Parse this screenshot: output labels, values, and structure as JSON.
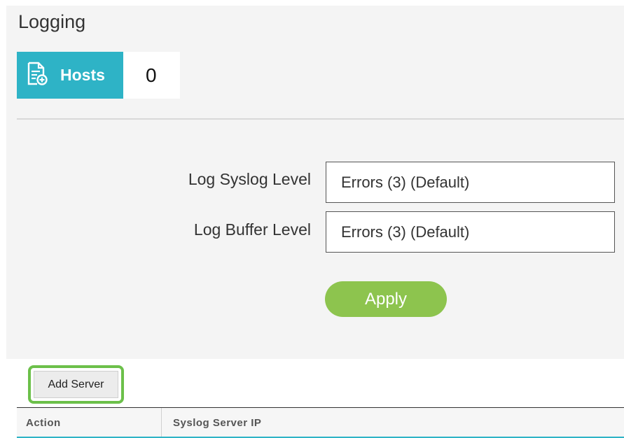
{
  "page": {
    "title": "Logging"
  },
  "hosts": {
    "icon": "document-add-icon",
    "label": "Hosts",
    "count": "0"
  },
  "form": {
    "syslog_label": "Log Syslog Level",
    "syslog_value": "Errors (3) (Default)",
    "buffer_label": "Log Buffer Level",
    "buffer_value": "Errors (3) (Default)",
    "apply_label": "Apply"
  },
  "servers": {
    "add_label": "Add Server",
    "columns": [
      "Action",
      "Syslog Server IP"
    ]
  },
  "colors": {
    "accent": "#2eb3c6",
    "apply": "#8dc44e",
    "highlight": "#6cc04a"
  }
}
